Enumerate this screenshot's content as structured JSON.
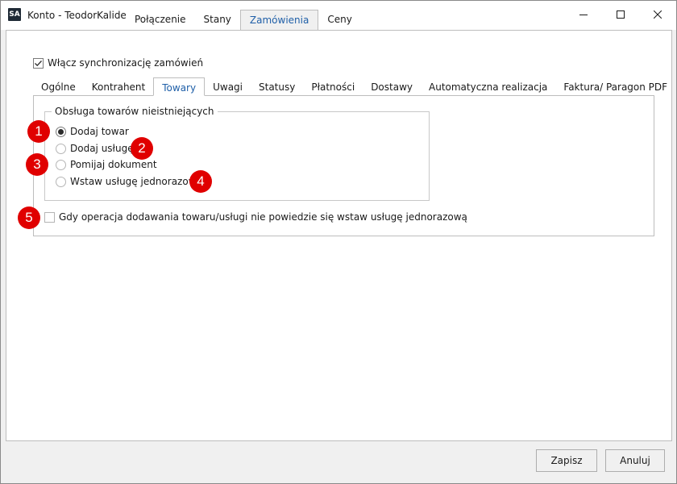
{
  "window": {
    "app_icon_text": "SA",
    "title": "Konto - TeodorKalide",
    "top_tabs": [
      {
        "label": "Połączenie",
        "active": false
      },
      {
        "label": "Stany",
        "active": false
      },
      {
        "label": "Zamówienia",
        "active": true
      },
      {
        "label": "Ceny",
        "active": false
      }
    ],
    "controls": {
      "minimize": "minimize-icon",
      "maximize": "maximize-icon",
      "close": "close-icon"
    }
  },
  "sync": {
    "label": "Włącz synchronizację zamówień",
    "checked": true
  },
  "inner_tabs": [
    {
      "label": "Ogólne",
      "active": false
    },
    {
      "label": "Kontrahent",
      "active": false
    },
    {
      "label": "Towary",
      "active": true
    },
    {
      "label": "Uwagi",
      "active": false
    },
    {
      "label": "Statusy",
      "active": false
    },
    {
      "label": "Płatności",
      "active": false
    },
    {
      "label": "Dostawy",
      "active": false
    },
    {
      "label": "Automatyczna realizacja",
      "active": false
    },
    {
      "label": "Faktura/ Paragon PDF",
      "active": false
    }
  ],
  "group": {
    "legend": "Obsługa towarów nieistniejących",
    "options": [
      {
        "label": "Dodaj towar",
        "checked": true
      },
      {
        "label": "Dodaj usługę",
        "checked": false
      },
      {
        "label": "Pomijaj dokument",
        "checked": false
      },
      {
        "label": "Wstaw usługę jednorazową",
        "checked": false
      }
    ]
  },
  "fallback": {
    "label": "Gdy operacja dodawania towaru/usługi nie powiedzie się wstaw usługę jednorazową",
    "checked": false
  },
  "markers": [
    "1",
    "2",
    "3",
    "4",
    "5"
  ],
  "buttons": {
    "save": "Zapisz",
    "cancel": "Anuluj"
  },
  "colors": {
    "accent": "#1f5fa8",
    "marker": "#e00000"
  }
}
